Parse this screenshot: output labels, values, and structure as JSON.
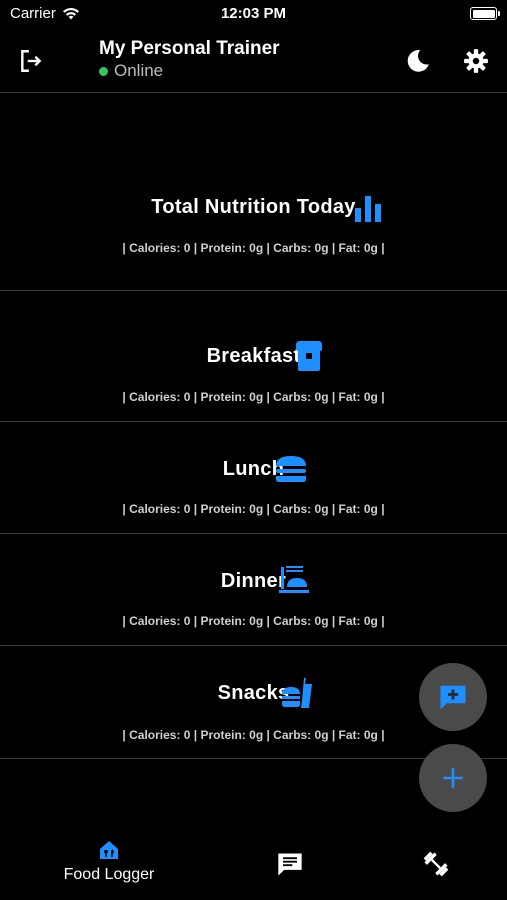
{
  "status_bar": {
    "carrier": "Carrier",
    "time": "12:03 PM"
  },
  "header": {
    "title": "My Personal Trainer",
    "status": "Online",
    "status_color": "#34c759"
  },
  "total": {
    "title": "Total Nutrition Today",
    "stats": "| Calories: 0 | Protein: 0g | Carbs: 0g | Fat: 0g |"
  },
  "meals": [
    {
      "title": "Breakfast",
      "icon": "breakfast-icon",
      "stats": "| Calories: 0 | Protein: 0g | Carbs: 0g | Fat: 0g |"
    },
    {
      "title": "Lunch",
      "icon": "burger-icon",
      "stats": "| Calories: 0 | Protein: 0g | Carbs: 0g | Fat: 0g |"
    },
    {
      "title": "Dinner",
      "icon": "dinner-icon",
      "stats": "| Calories: 0 | Protein: 0g | Carbs: 0g | Fat: 0g |"
    },
    {
      "title": "Snacks",
      "icon": "fastfood-icon",
      "stats": "| Calories: 0 | Protein: 0g | Carbs: 0g | Fat: 0g |"
    }
  ],
  "nav": {
    "food_logger": "Food Logger"
  },
  "colors": {
    "accent": "#1e8fff",
    "background": "#000000",
    "fab": "#4a4a4a"
  }
}
